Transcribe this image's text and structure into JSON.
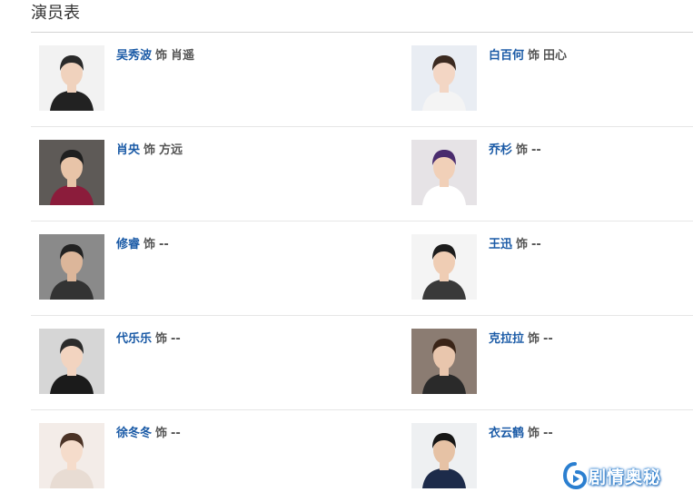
{
  "section": {
    "title": "演员表"
  },
  "cast": [
    {
      "actor": "吴秀波",
      "sep": "饰",
      "role": "肖遥",
      "photo_icon": "actor-portrait-icon",
      "photo_bg": "#f2f2f2"
    },
    {
      "actor": "白百何",
      "sep": "饰",
      "role": "田心",
      "photo_icon": "actor-portrait-icon",
      "photo_bg": "#e9edf3"
    },
    {
      "actor": "肖央",
      "sep": "饰",
      "role": "方远",
      "photo_icon": "actor-portrait-icon",
      "photo_bg": "#5e5a57"
    },
    {
      "actor": "乔杉",
      "sep": "饰",
      "role": "--",
      "photo_icon": "actor-portrait-icon",
      "photo_bg": "#e6e3e6"
    },
    {
      "actor": "修睿",
      "sep": "饰",
      "role": "--",
      "photo_icon": "actor-portrait-icon",
      "photo_bg": "#8a8a8a"
    },
    {
      "actor": "王迅",
      "sep": "饰",
      "role": "--",
      "photo_icon": "actor-portrait-icon",
      "photo_bg": "#f4f4f4"
    },
    {
      "actor": "代乐乐",
      "sep": "饰",
      "role": "--",
      "photo_icon": "actor-portrait-icon",
      "photo_bg": "#d6d6d6"
    },
    {
      "actor": "克拉拉",
      "sep": "饰",
      "role": "--",
      "photo_icon": "actor-portrait-icon",
      "photo_bg": "#8b7c72"
    },
    {
      "actor": "徐冬冬",
      "sep": "饰",
      "role": "--",
      "photo_icon": "actor-portrait-icon",
      "photo_bg": "#f3ece8"
    },
    {
      "actor": "衣云鹤",
      "sep": "饰",
      "role": "--",
      "photo_icon": "actor-portrait-icon",
      "photo_bg": "#eef0f2"
    }
  ],
  "watermark": {
    "text": "剧情奥秘",
    "icon": "play-logo-icon",
    "color": "#2b7fd0"
  },
  "colors": {
    "actor_link": "#1a5aa6",
    "role_text": "#555555",
    "divider": "#e6e6e6"
  }
}
